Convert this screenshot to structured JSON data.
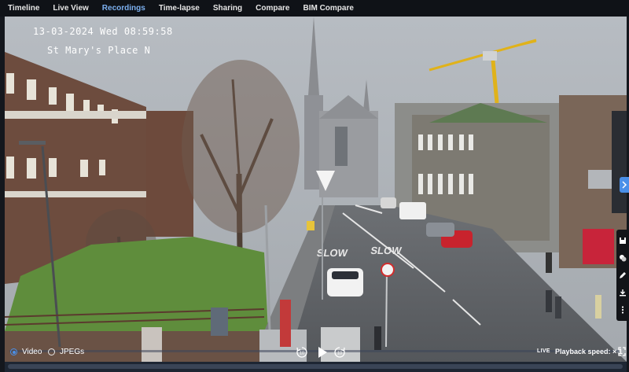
{
  "nav": {
    "tabs": [
      {
        "label": "Timeline"
      },
      {
        "label": "Live View"
      },
      {
        "label": "Recordings"
      },
      {
        "label": "Time-lapse"
      },
      {
        "label": "Sharing"
      },
      {
        "label": "Compare"
      },
      {
        "label": "BIM Compare"
      }
    ],
    "active_tab": "Recordings"
  },
  "overlay": {
    "timestamp": "13-03-2024 Wed 08:59:58",
    "location": "St Mary's Place N"
  },
  "road_markings": {
    "left": "SLOW",
    "right": "SLOW"
  },
  "controls": {
    "mode_video": "Video",
    "mode_jpegs": "JPEGs",
    "selected_mode": "Video",
    "rewind_seconds": "10",
    "forward_seconds": "10",
    "live_label": "LIVE",
    "playback_speed": "Playback speed: × 1"
  },
  "colors": {
    "accent": "#4a8fe8",
    "active_tab": "#7cb0f0",
    "toolbar_bg": "#0f1217"
  },
  "icons": [
    "play-icon",
    "rewind-10-icon",
    "forward-10-icon",
    "fullscreen-icon",
    "chevron-right-icon",
    "save-icon",
    "layers-icon",
    "edit-icon",
    "download-icon",
    "more-icon"
  ]
}
